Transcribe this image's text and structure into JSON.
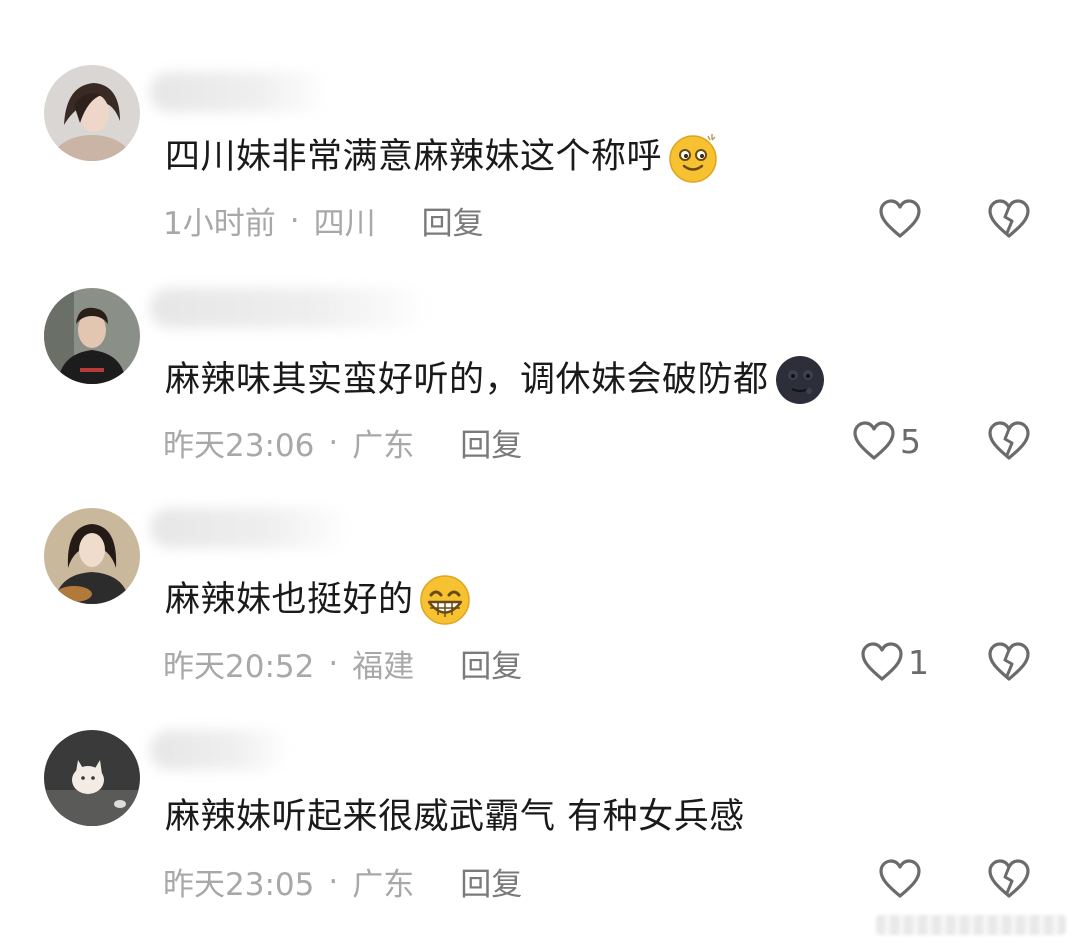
{
  "comments": [
    {
      "text": "四川妹非常满意麻辣妹这个称呼",
      "emoji": "smiling-face-emoji",
      "time": "1小时前",
      "location": "四川",
      "reply": "回复",
      "likes": ""
    },
    {
      "text": "麻辣味其实蛮好听的，调休妹会破防都",
      "emoji": "dark-moon-face-emoji",
      "time": "昨天23:06",
      "location": "广东",
      "reply": "回复",
      "likes": "5"
    },
    {
      "text": "麻辣妹也挺好的",
      "emoji": "grinning-teeth-emoji",
      "time": "昨天20:52",
      "location": "福建",
      "reply": "回复",
      "likes": "1"
    },
    {
      "text": "麻辣妹听起来很威武霸气 有种女兵感",
      "emoji": "",
      "time": "昨天23:05",
      "location": "广东",
      "reply": "回复",
      "likes": ""
    }
  ],
  "meta_separator": "·",
  "icons": {
    "like": "heart-outline-icon",
    "dislike": "broken-heart-icon"
  },
  "colors": {
    "text": "#1a1a1a",
    "meta": "#a8a8a8",
    "reply": "#7a7a7a",
    "icon": "#6b6b6b"
  }
}
